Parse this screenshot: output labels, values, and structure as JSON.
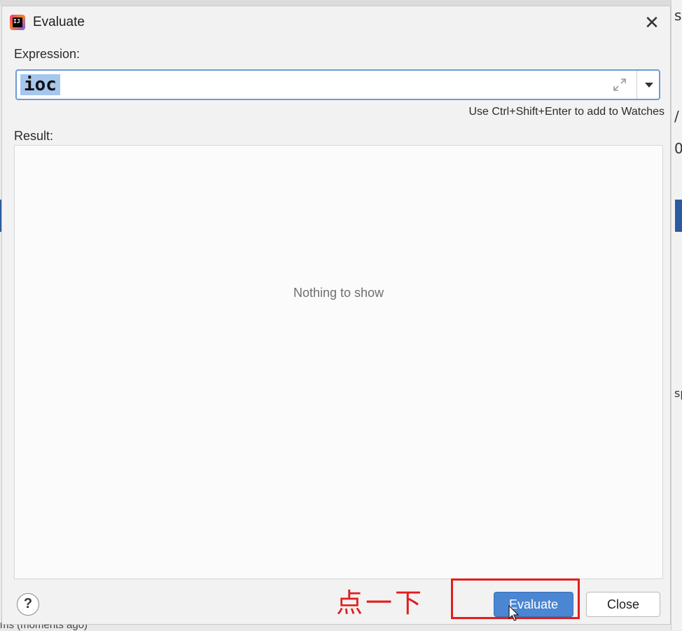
{
  "dialog": {
    "title": "Evaluate",
    "icon_text": "IJ",
    "close_icon": "close-icon"
  },
  "expression": {
    "label": "Expression:",
    "value": "ioc",
    "hint": "Use Ctrl+Shift+Enter to add to Watches"
  },
  "result": {
    "label": "Result:",
    "empty_text": "Nothing to show"
  },
  "footer": {
    "help_label": "?",
    "evaluate_label": "Evaluate",
    "close_label": "Close"
  },
  "annotation": {
    "text": "点一下",
    "color": "#e21d1d"
  },
  "background": {
    "bottom_text": "ms (moments ago)",
    "right_text_1": "s",
    "right_text_2": "/",
    "right_text_3": "0",
    "right_text_4": "sp"
  },
  "colors": {
    "primary_button": "#4a86d2",
    "focus_border": "#6f9bd6",
    "selection": "#a6c6ee"
  }
}
